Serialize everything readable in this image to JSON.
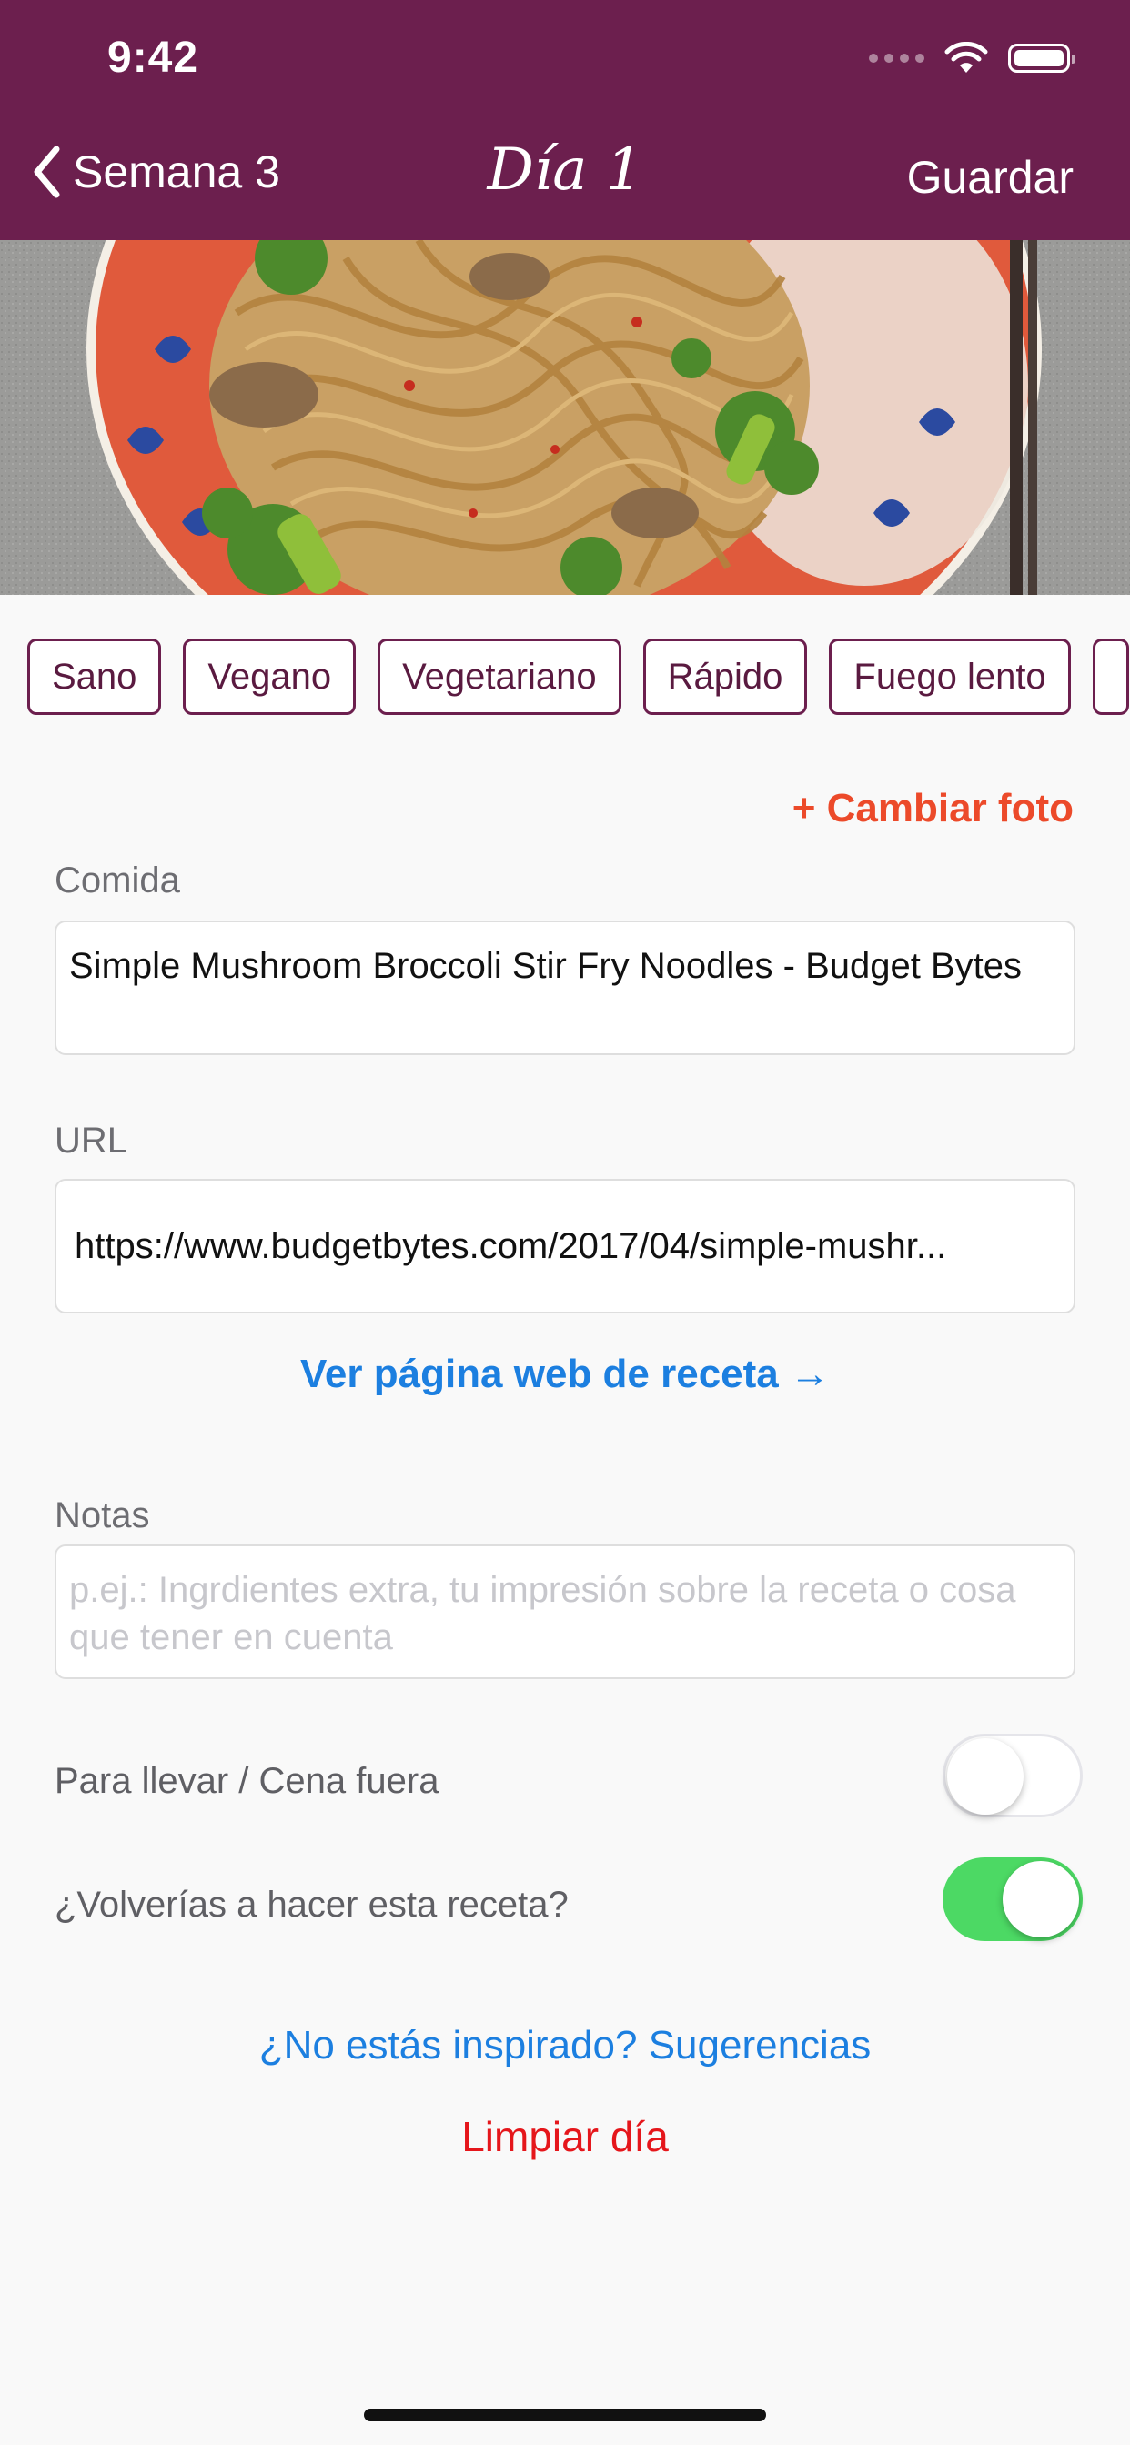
{
  "status_bar": {
    "time": "9:42",
    "icons": [
      "signal-icon",
      "wifi-icon",
      "battery-icon"
    ]
  },
  "nav": {
    "back_label": "Semana 3",
    "title": "Día 1",
    "save_label": "Guardar"
  },
  "hero": {
    "image_description": "plate-of-noodles-photo"
  },
  "tags": [
    "Sano",
    "Vegano",
    "Vegetariano",
    "Rápido",
    "Fuego lento"
  ],
  "change_photo": "+ Cambiar foto",
  "meal": {
    "label": "Comida",
    "value": "Simple Mushroom Broccoli Stir Fry Noodles - Budget Bytes"
  },
  "url": {
    "label": "URL",
    "value": "https://www.budgetbytes.com/2017/04/simple-mushr..."
  },
  "recipe_link": "Ver página web de receta →",
  "notes": {
    "label": "Notas",
    "placeholder": "p.ej.: Ingrdientes extra, tu impresión sobre la receta o cosa que tener en cuenta"
  },
  "toggles": [
    {
      "label": "Para llevar / Cena fuera",
      "on": false
    },
    {
      "label": "¿Volverías a hacer esta receta?",
      "on": true
    }
  ],
  "suggestions_link": "¿No estás inspirado? Sugerencias",
  "clear_link": "Limpiar día",
  "colors": {
    "header": "#6c1f4e",
    "accent_orange": "#ec4a2a",
    "link_blue": "#1c7fe0",
    "danger_red": "#e5161b",
    "switch_on": "#4cd964"
  }
}
